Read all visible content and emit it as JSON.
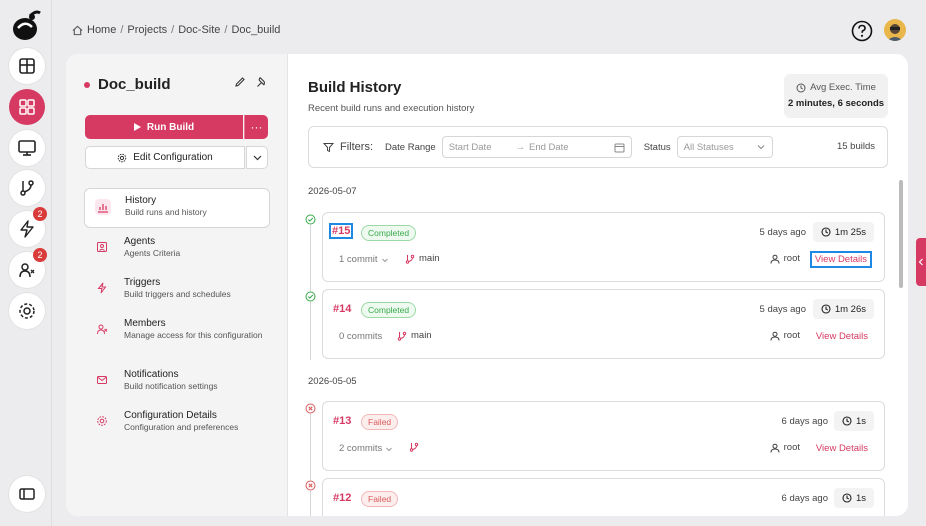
{
  "breadcrumb": [
    "Home",
    "Projects",
    "Doc-Site",
    "Doc_build"
  ],
  "rail": {
    "icons": [
      "logo",
      "dashboard-icon",
      "grid-icon",
      "monitor-icon",
      "branch-icon",
      "lightning-icon",
      "users-icon",
      "settings-icon",
      "sidebar-toggle-icon"
    ],
    "badges": {
      "lightning": "2",
      "users": "2"
    }
  },
  "project": {
    "title": "Doc_build",
    "run_label": "Run Build",
    "more_label": "···",
    "config_label": "Edit Configuration"
  },
  "nav": [
    {
      "title": "History",
      "sub": "Build runs and history"
    },
    {
      "title": "Agents",
      "sub": "Agents Criteria"
    },
    {
      "title": "Triggers",
      "sub": "Build triggers and schedules"
    },
    {
      "title": "Members",
      "sub": "Manage access for this configuration"
    },
    {
      "title": "Notifications",
      "sub": "Build notification settings"
    },
    {
      "title": "Configuration Details",
      "sub": "Configuration and preferences"
    }
  ],
  "history": {
    "title": "Build History",
    "subtitle": "Recent build runs and execution history",
    "avg_label": "Avg Exec. Time",
    "avg_value": "2 minutes, 6 seconds"
  },
  "filters": {
    "label": "Filters:",
    "date_range_label": "Date Range",
    "start_placeholder": "Start Date",
    "end_placeholder": "End Date",
    "status_label": "Status",
    "status_value": "All Statuses",
    "count": "15 builds"
  },
  "groups": [
    {
      "date": "2026-05-07"
    },
    {
      "date": "2026-05-05"
    }
  ],
  "runs": [
    {
      "num": "#15",
      "status": "Completed",
      "ago": "5 days ago",
      "duration": "1m 25s",
      "commits": "1 commit",
      "branch": "main",
      "user": "root",
      "details": "View Details"
    },
    {
      "num": "#14",
      "status": "Completed",
      "ago": "5 days ago",
      "duration": "1m 26s",
      "commits": "0 commits",
      "branch": "main",
      "user": "root",
      "details": "View Details"
    },
    {
      "num": "#13",
      "status": "Failed",
      "ago": "6 days ago",
      "duration": "1s",
      "commits": "2 commits",
      "branch": "",
      "user": "root",
      "details": "View Details"
    },
    {
      "num": "#12",
      "status": "Failed",
      "ago": "6 days ago",
      "duration": "1s"
    }
  ],
  "colors": {
    "accent": "#d63a63",
    "success": "#38a94b",
    "error": "#d85a5a",
    "highlight": "#1e88e5"
  }
}
